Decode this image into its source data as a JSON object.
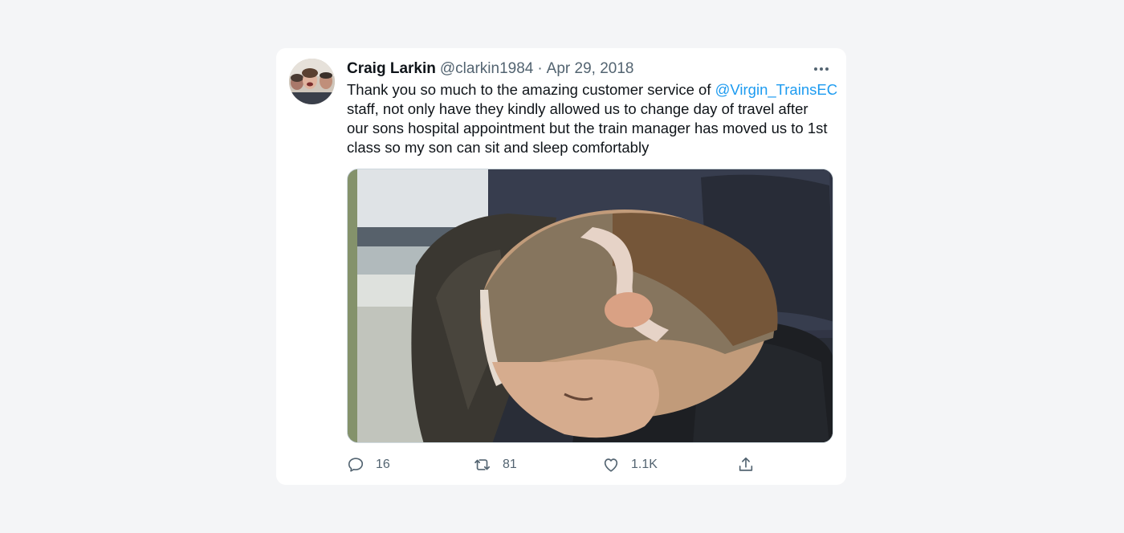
{
  "tweet": {
    "display_name": "Craig Larkin",
    "handle": "@clarkin1984",
    "separator": "·",
    "date": "Apr 29, 2018",
    "text_lines": [
      {
        "before": "Thank you so much to the amazing customer service of ",
        "mention": "@Virgin_TrainsEC"
      },
      {
        "before": "staff, not only have they kindly allowed us to change day of travel after"
      },
      {
        "before": "our sons hospital appointment but the train manager has moved us to 1st"
      },
      {
        "before": "class so my son can sit and sleep comfortably"
      }
    ]
  },
  "actions": {
    "reply_count": "16",
    "retweet_count": "81",
    "like_count": "1.1K"
  },
  "icons": {
    "more": "more-icon",
    "reply": "reply-icon",
    "retweet": "retweet-icon",
    "like": "heart-icon",
    "share": "share-icon"
  },
  "colors": {
    "mention": "#1d9bf0",
    "secondary_text": "#536471",
    "background": "#f4f5f7",
    "card": "#ffffff"
  }
}
